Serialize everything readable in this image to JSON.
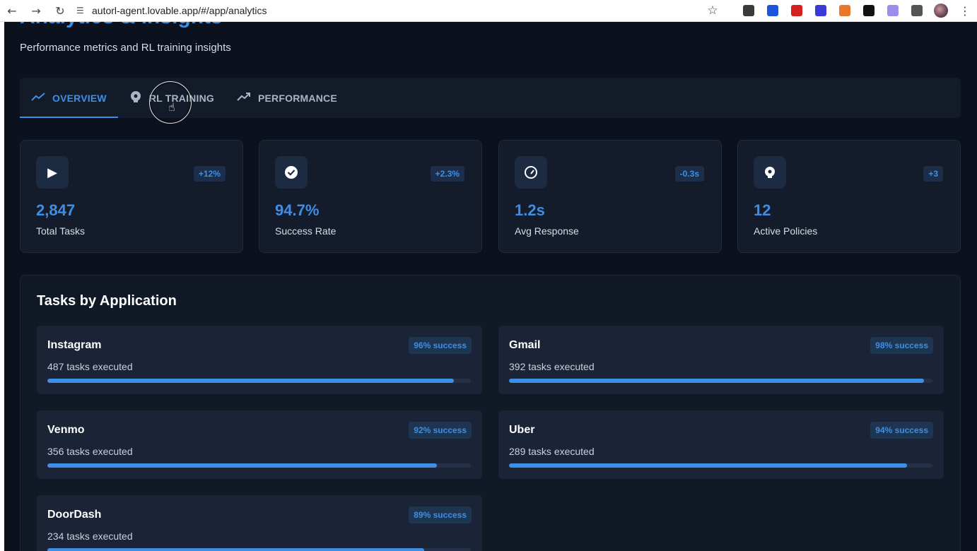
{
  "browser": {
    "url": "autorl-agent.lovable.app/#/app/analytics",
    "extension_colors": [
      "#3a3a3a",
      "#1a56db",
      "#d42020",
      "#3a3ad8",
      "#e8762b",
      "#111111",
      "#9a8cf0",
      "#555555"
    ]
  },
  "header": {
    "title": "Analytics & Insights",
    "subtitle": "Performance metrics and RL training insights"
  },
  "tabs": [
    {
      "label": "OVERVIEW",
      "icon": "trending-line-icon",
      "active": true
    },
    {
      "label": "RL TRAINING",
      "icon": "brain-icon",
      "active": false
    },
    {
      "label": "PERFORMANCE",
      "icon": "trending-up-icon",
      "active": false
    }
  ],
  "stats": [
    {
      "icon": "play-icon",
      "delta": "+12%",
      "value": "2,847",
      "label": "Total Tasks"
    },
    {
      "icon": "check-circle-icon",
      "delta": "+2.3%",
      "value": "94.7%",
      "label": "Success Rate"
    },
    {
      "icon": "gauge-icon",
      "delta": "-0.3s",
      "value": "1.2s",
      "label": "Avg Response"
    },
    {
      "icon": "brain-icon",
      "delta": "+3",
      "value": "12",
      "label": "Active Policies"
    }
  ],
  "apps_section": {
    "title": "Tasks by Application",
    "apps": [
      {
        "name": "Instagram",
        "badge": "96% success",
        "tasks": "487 tasks executed",
        "success": 0.96
      },
      {
        "name": "Gmail",
        "badge": "98% success",
        "tasks": "392 tasks executed",
        "success": 0.98
      },
      {
        "name": "Venmo",
        "badge": "92% success",
        "tasks": "356 tasks executed",
        "success": 0.92
      },
      {
        "name": "Uber",
        "badge": "94% success",
        "tasks": "289 tasks executed",
        "success": 0.94
      },
      {
        "name": "DoorDash",
        "badge": "89% success",
        "tasks": "234 tasks executed",
        "success": 0.89
      }
    ]
  },
  "colors": {
    "accent": "#3d8fe6",
    "background": "#0b111d",
    "card": "#141c2b"
  }
}
